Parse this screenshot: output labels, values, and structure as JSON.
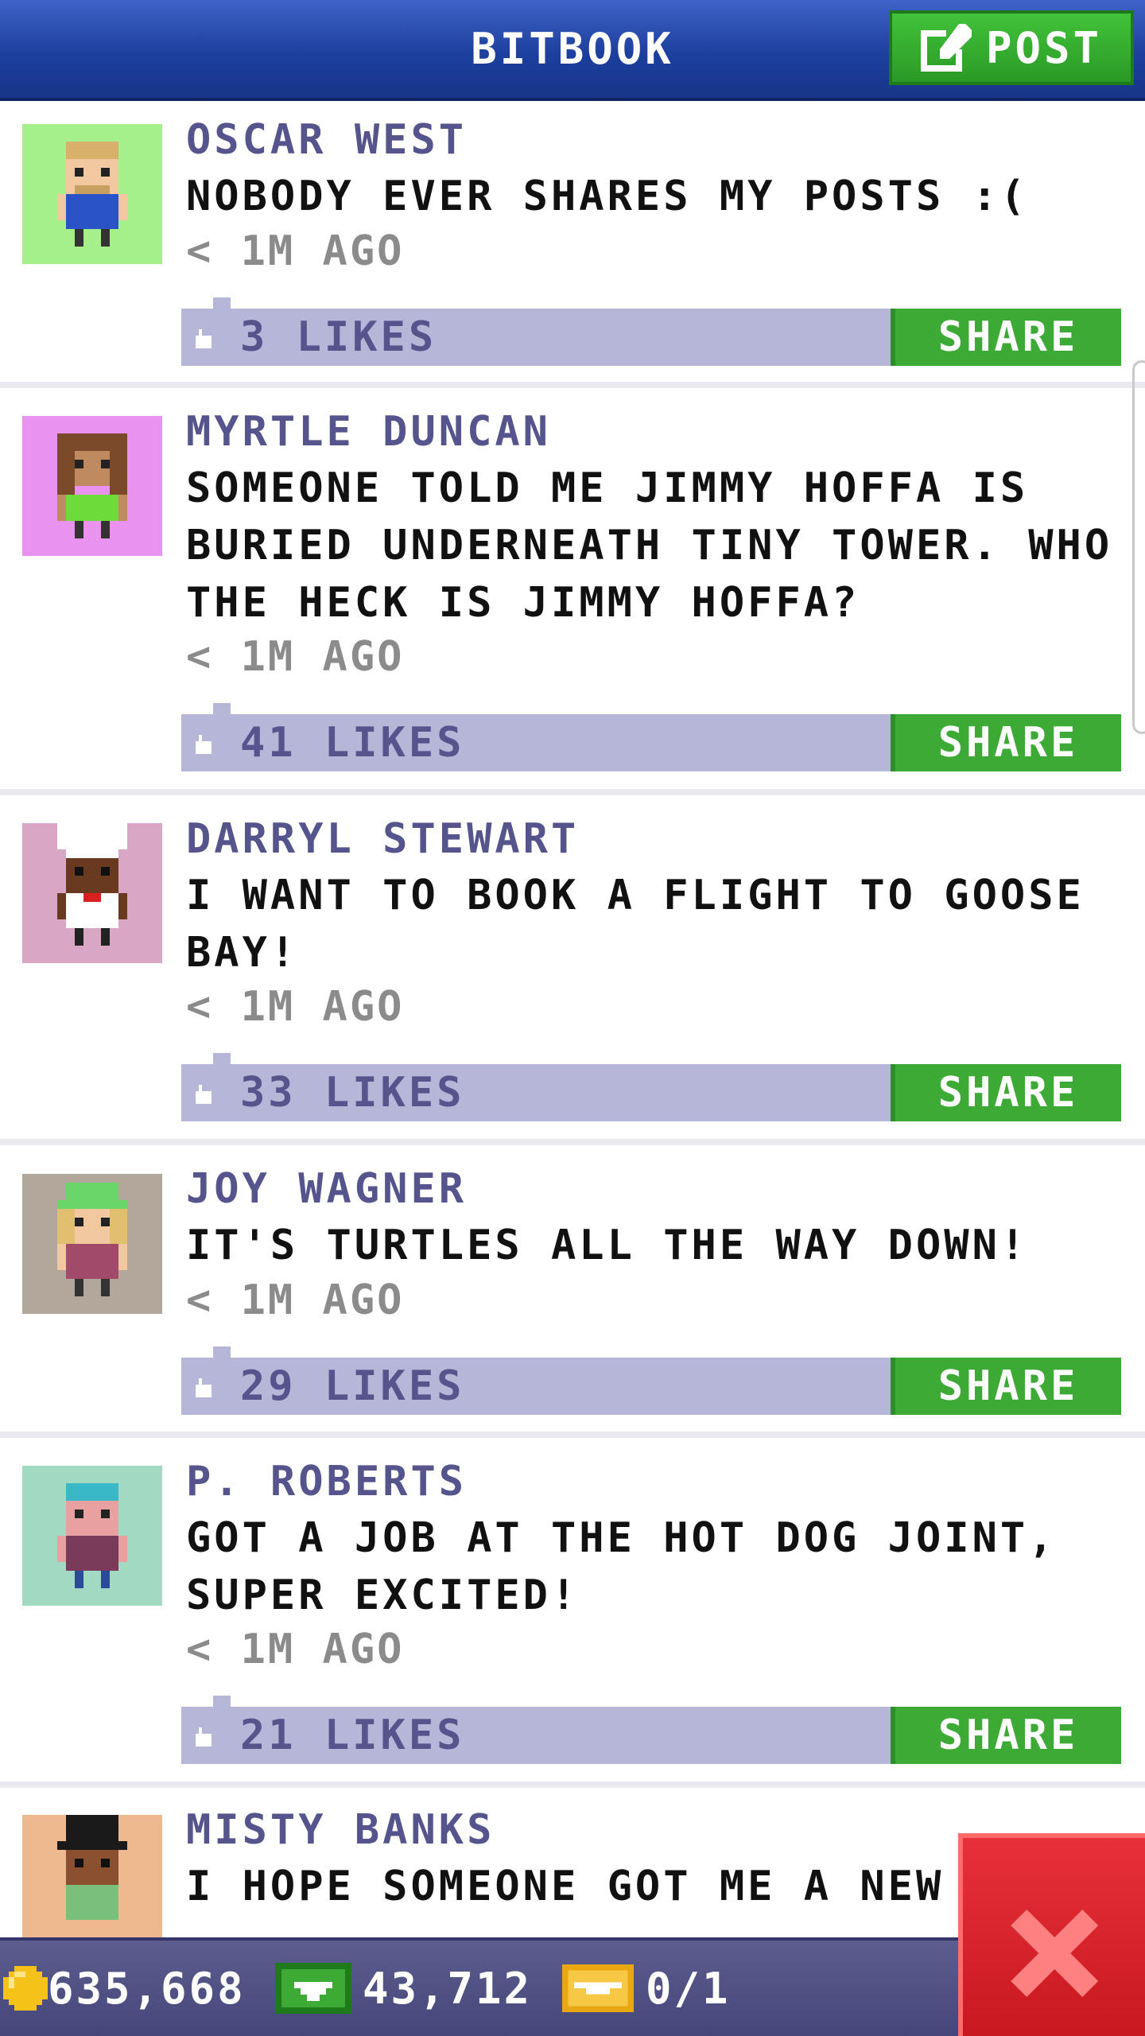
{
  "header": {
    "title": "BITBOOK",
    "post_label": "POST"
  },
  "posts": [
    {
      "author": "OSCAR WEST",
      "message": "NOBODY EVER SHARES MY POSTS :(",
      "time": "< 1M AGO",
      "likes": "3 LIKES",
      "share": "SHARE",
      "avatar_bg": "#a6f08c"
    },
    {
      "author": "MYRTLE DUNCAN",
      "message": "SOMEONE TOLD ME JIMMY HOFFA IS BURIED UNDERNEATH TINY TOWER. WHO THE HECK IS JIMMY HOFFA?",
      "time": "< 1M AGO",
      "likes": "41 LIKES",
      "share": "SHARE",
      "avatar_bg": "#ea92f0"
    },
    {
      "author": "DARRYL STEWART",
      "message": "I WANT TO BOOK A FLIGHT TO GOOSE BAY!",
      "time": "< 1M AGO",
      "likes": "33 LIKES",
      "share": "SHARE",
      "avatar_bg": "#d9a6c6"
    },
    {
      "author": "JOY WAGNER",
      "message": "IT'S TURTLES ALL THE WAY DOWN!",
      "time": "< 1M AGO",
      "likes": "29 LIKES",
      "share": "SHARE",
      "avatar_bg": "#b3a69b"
    },
    {
      "author": "P. ROBERTS",
      "message": "GOT A JOB AT THE HOT DOG JOINT, SUPER EXCITED!",
      "time": "< 1M AGO",
      "likes": "21 LIKES",
      "share": "SHARE",
      "avatar_bg": "#a2d9c3"
    },
    {
      "author": "MISTY BANKS",
      "message": "I HOPE SOMEONE GOT ME A NEW",
      "time": "",
      "likes": "",
      "share": "",
      "avatar_bg": "#eeb98f"
    }
  ],
  "status": {
    "coins": "635,668",
    "bux": "43,712",
    "tickets": "0/1"
  },
  "colors": {
    "header": "#1d3f9e",
    "share_green": "#3eaa36",
    "like_bar": "#b5b6d8",
    "author_text": "#55548c",
    "close_red": "#d8222a"
  },
  "icons": {
    "post": "edit-icon",
    "like": "thumbs-up-icon",
    "coin": "coin-icon",
    "bux": "bux-icon",
    "ticket": "ticket-icon",
    "close": "close-icon"
  }
}
